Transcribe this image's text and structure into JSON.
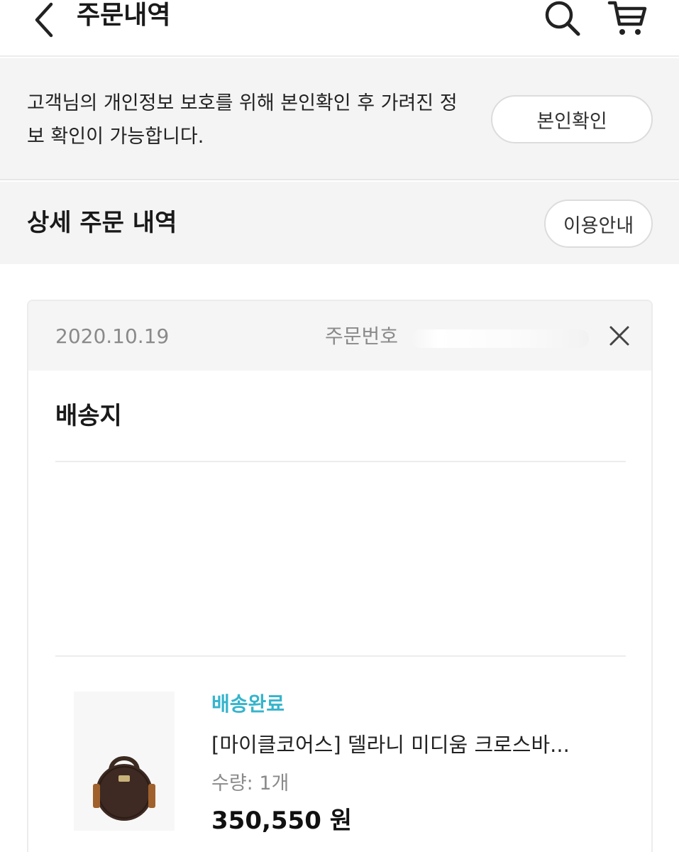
{
  "header": {
    "title": "주문내역",
    "back_icon": "chevron-left-icon",
    "search_icon": "search-icon",
    "cart_icon": "cart-icon"
  },
  "notice": {
    "text": "고객님의 개인정보 보호를 위해 본인확인 후 가려진 정보 확인이 가능합니다.",
    "verify_label": "본인확인"
  },
  "detail": {
    "title": "상세 주문 내역",
    "guide_label": "이용안내"
  },
  "order": {
    "date": "2020.10.19",
    "order_no_label": "주문번호",
    "shipping_title": "배송지",
    "product": {
      "status": "배송완료",
      "name": "[마이클코어스] 델라니 미디움 크로스바...",
      "quantity": "수량: 1개",
      "price": "350,550 원"
    }
  },
  "colors": {
    "status": "#35b4cc",
    "panel_bg": "#f4f4f4"
  }
}
